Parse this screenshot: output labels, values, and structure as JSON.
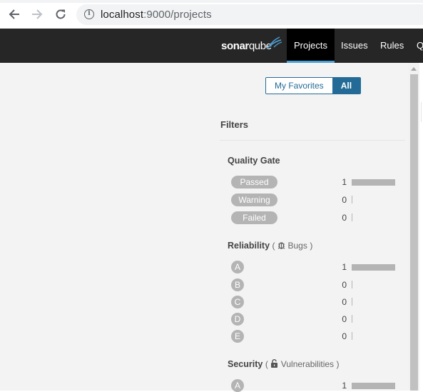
{
  "browser": {
    "url_host": "localhost",
    "url_rest": ":9000/projects"
  },
  "nav": {
    "logo_bold": "sonar",
    "logo_light": "qube",
    "items": [
      {
        "label": "Projects",
        "active": true
      },
      {
        "label": "Issues",
        "active": false
      },
      {
        "label": "Rules",
        "active": false
      },
      {
        "label": "Q",
        "active": false
      }
    ]
  },
  "toggle": {
    "favorites_label": "My Favorites",
    "all_label": "All",
    "selected": "All"
  },
  "filters": {
    "title": "Filters",
    "quality_gate": {
      "title": "Quality Gate",
      "options": [
        {
          "label": "Passed",
          "count": "1",
          "fraction": 1
        },
        {
          "label": "Warning",
          "count": "0",
          "fraction": 0
        },
        {
          "label": "Failed",
          "count": "0",
          "fraction": 0
        }
      ]
    },
    "reliability": {
      "title": "Reliability",
      "open": "(",
      "sub": "Bugs",
      "close": ")",
      "icon": "bug-icon",
      "options": [
        {
          "label": "A",
          "count": "1",
          "fraction": 1
        },
        {
          "label": "B",
          "count": "0",
          "fraction": 0
        },
        {
          "label": "C",
          "count": "0",
          "fraction": 0
        },
        {
          "label": "D",
          "count": "0",
          "fraction": 0
        },
        {
          "label": "E",
          "count": "0",
          "fraction": 0
        }
      ]
    },
    "security": {
      "title": "Security",
      "open": "(",
      "sub": "Vulnerabilities",
      "close": ")",
      "icon": "lock-open-icon",
      "options": [
        {
          "label": "A",
          "count": "1",
          "fraction": 1
        }
      ]
    }
  },
  "colors": {
    "nav_bg": "#262626",
    "accent": "#236a97",
    "facet_gray": "#b4b4b4"
  }
}
